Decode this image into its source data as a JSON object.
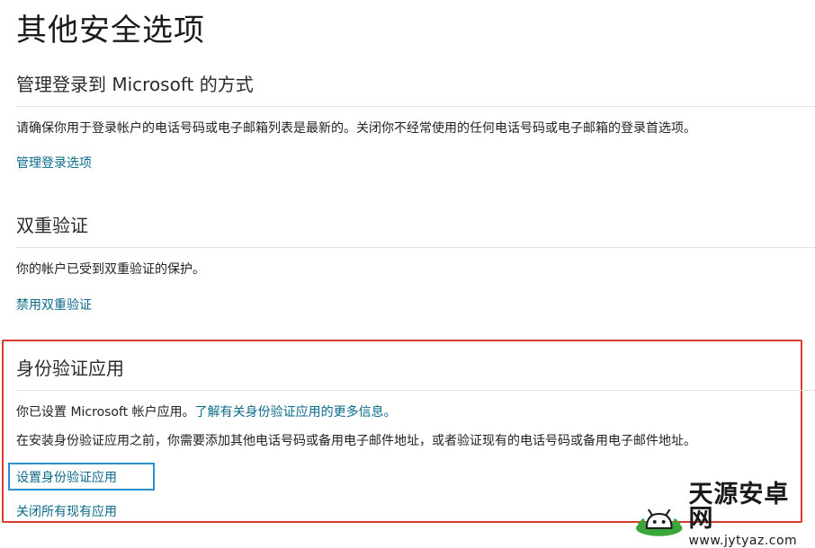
{
  "page": {
    "title": "其他安全选项"
  },
  "sections": {
    "signin": {
      "title": "管理登录到 Microsoft 的方式",
      "description": "请确保你用于登录帐户的电话号码或电子邮箱列表是最新的。关闭你不经常使用的任何电话号码或电子邮箱的登录首选项。",
      "link": "管理登录选项"
    },
    "two_step": {
      "title": "双重验证",
      "description": "你的帐户已受到双重验证的保护。",
      "link": "禁用双重验证"
    },
    "authenticator": {
      "title": "身份验证应用",
      "status_text": "你已设置 Microsoft 帐户应用。",
      "learn_more_link": "了解有关身份验证应用的更多信息。",
      "note": "在安装身份验证应用之前，你需要添加其他电话号码或备用电子邮件地址，或者验证现有的电话号码或备用电子邮件地址。",
      "setup_button": "设置身份验证应用",
      "turn_off_link": "关闭所有现有应用"
    }
  },
  "watermark": {
    "name": "天源安卓网",
    "url": "www.jytyaz.com",
    "icon": "android-robot-icon"
  },
  "colors": {
    "link": "#0b6a8a",
    "highlight_border": "#d63b2f",
    "focus_border": "#2b8fcb",
    "divider": "#e1e1e1"
  }
}
